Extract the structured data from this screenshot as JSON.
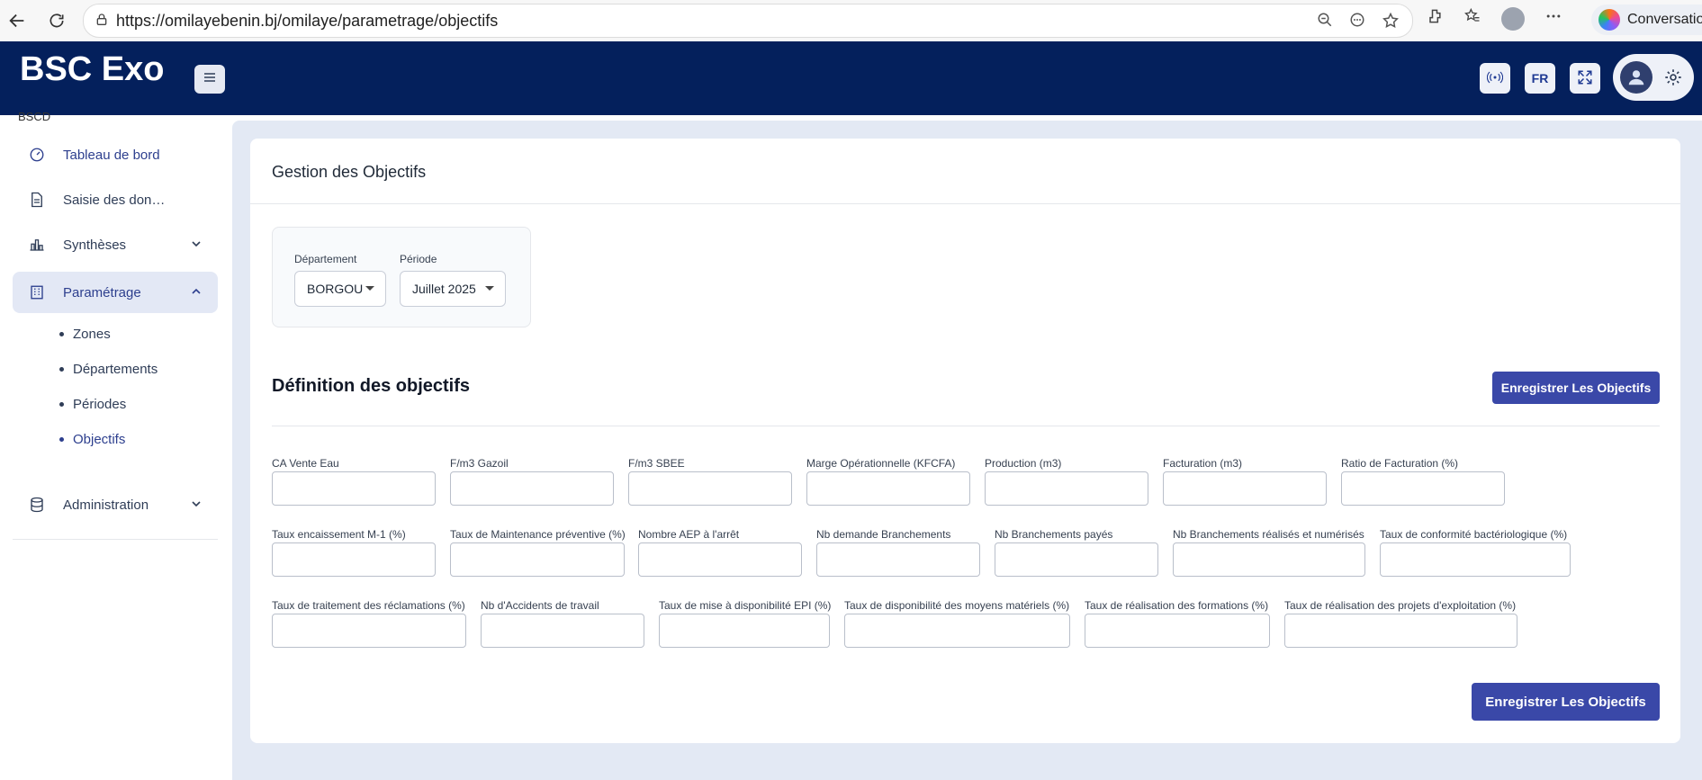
{
  "browser": {
    "url": "https://omilayebenin.bj/omilaye/parametrage/objectifs",
    "copilot_label": "Conversation"
  },
  "header": {
    "app_title": "BSC Exo",
    "lang_label": "FR"
  },
  "sidebar": {
    "cut_label": "BSCD",
    "items": [
      {
        "label": "Tableau de bord",
        "icon": "dashboard-gauge-icon"
      },
      {
        "label": "Saisie des don…",
        "icon": "document-icon"
      },
      {
        "label": "Synthèses",
        "icon": "bar-chart-icon"
      },
      {
        "label": "Paramétrage",
        "icon": "building-icon"
      },
      {
        "label": "Administration",
        "icon": "database-icon"
      }
    ],
    "sub_items": [
      {
        "label": "Zones"
      },
      {
        "label": "Départements"
      },
      {
        "label": "Périodes"
      },
      {
        "label": "Objectifs"
      }
    ]
  },
  "page": {
    "card_title": "Gestion des Objectifs",
    "filters": {
      "departement_label": "Département",
      "departement_value": "BORGOU",
      "periode_label": "Période",
      "periode_value": "Juillet 2025"
    },
    "section_title": "Définition des objectifs",
    "save_button_top": "Enregistrer Les Objectifs",
    "save_button_bottom": "Enregistrer Les Objectifs",
    "fields": [
      {
        "label": "CA Vente Eau",
        "value": ""
      },
      {
        "label": "F/m3 Gazoil",
        "value": ""
      },
      {
        "label": "F/m3 SBEE",
        "value": ""
      },
      {
        "label": "Marge Opérationnelle (KFCFA)",
        "value": ""
      },
      {
        "label": "Production (m3)",
        "value": ""
      },
      {
        "label": "Facturation (m3)",
        "value": ""
      },
      {
        "label": "Ratio de Facturation (%)",
        "value": ""
      },
      {
        "label": "Taux encaissement M-1 (%)",
        "value": ""
      },
      {
        "label": "Taux de Maintenance préventive (%)",
        "value": ""
      },
      {
        "label": "Nombre AEP à l'arrêt",
        "value": ""
      },
      {
        "label": "Nb demande Branchements",
        "value": ""
      },
      {
        "label": "Nb Branchements payés",
        "value": ""
      },
      {
        "label": "Nb Branchements réalisés et numérisés",
        "value": ""
      },
      {
        "label": "Taux de conformité bactériologique (%)",
        "value": ""
      },
      {
        "label": "Taux de traitement des réclamations (%)",
        "value": ""
      },
      {
        "label": "Nb d'Accidents de travail",
        "value": ""
      },
      {
        "label": "Taux de mise à disponibilité EPI (%)",
        "value": ""
      },
      {
        "label": "Taux de disponibilité des moyens matériels (%)",
        "value": ""
      },
      {
        "label": "Taux de réalisation des formations (%)",
        "value": ""
      },
      {
        "label": "Taux de réalisation des projets d'exploitation (%)",
        "value": ""
      }
    ]
  }
}
